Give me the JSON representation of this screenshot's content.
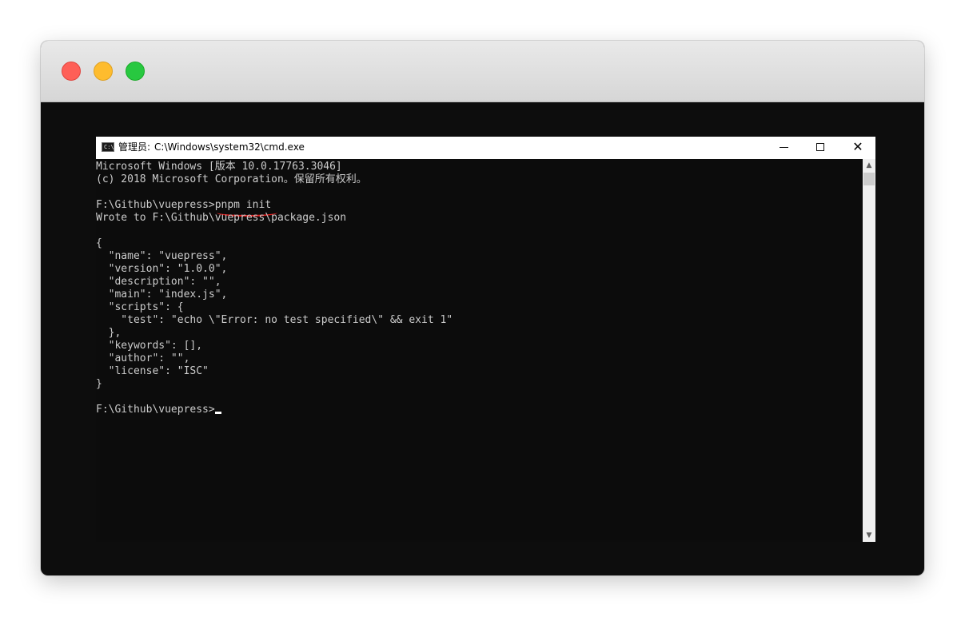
{
  "window": {
    "title_prefix": "管理员:",
    "title_path": "C:\\Windows\\system32\\cmd.exe",
    "icon_glyph": "C:\\"
  },
  "caption": {
    "minimize": "—",
    "maximize": "☐",
    "close": "✕"
  },
  "terminal": {
    "lines": [
      "Microsoft Windows [版本 10.0.17763.3046]",
      "(c) 2018 Microsoft Corporation。保留所有权利。",
      "",
      "F:\\Github\\vuepress>pnpm init",
      "Wrote to F:\\Github\\vuepress\\package.json",
      "",
      "{",
      "  \"name\": \"vuepress\",",
      "  \"version\": \"1.0.0\",",
      "  \"description\": \"\",",
      "  \"main\": \"index.js\",",
      "  \"scripts\": {",
      "    \"test\": \"echo \\\"Error: no test specified\\\" && exit 1\"",
      "  },",
      "  \"keywords\": [],",
      "  \"author\": \"\",",
      "  \"license\": \"ISC\"",
      "}",
      "",
      "F:\\Github\\vuepress>"
    ]
  },
  "scrollbar": {
    "up": "▲",
    "down": "▼"
  },
  "colors": {
    "terminal_bg": "#0c0c0c",
    "terminal_text": "#cccccc",
    "annotation_underline": "#e41e1e"
  }
}
